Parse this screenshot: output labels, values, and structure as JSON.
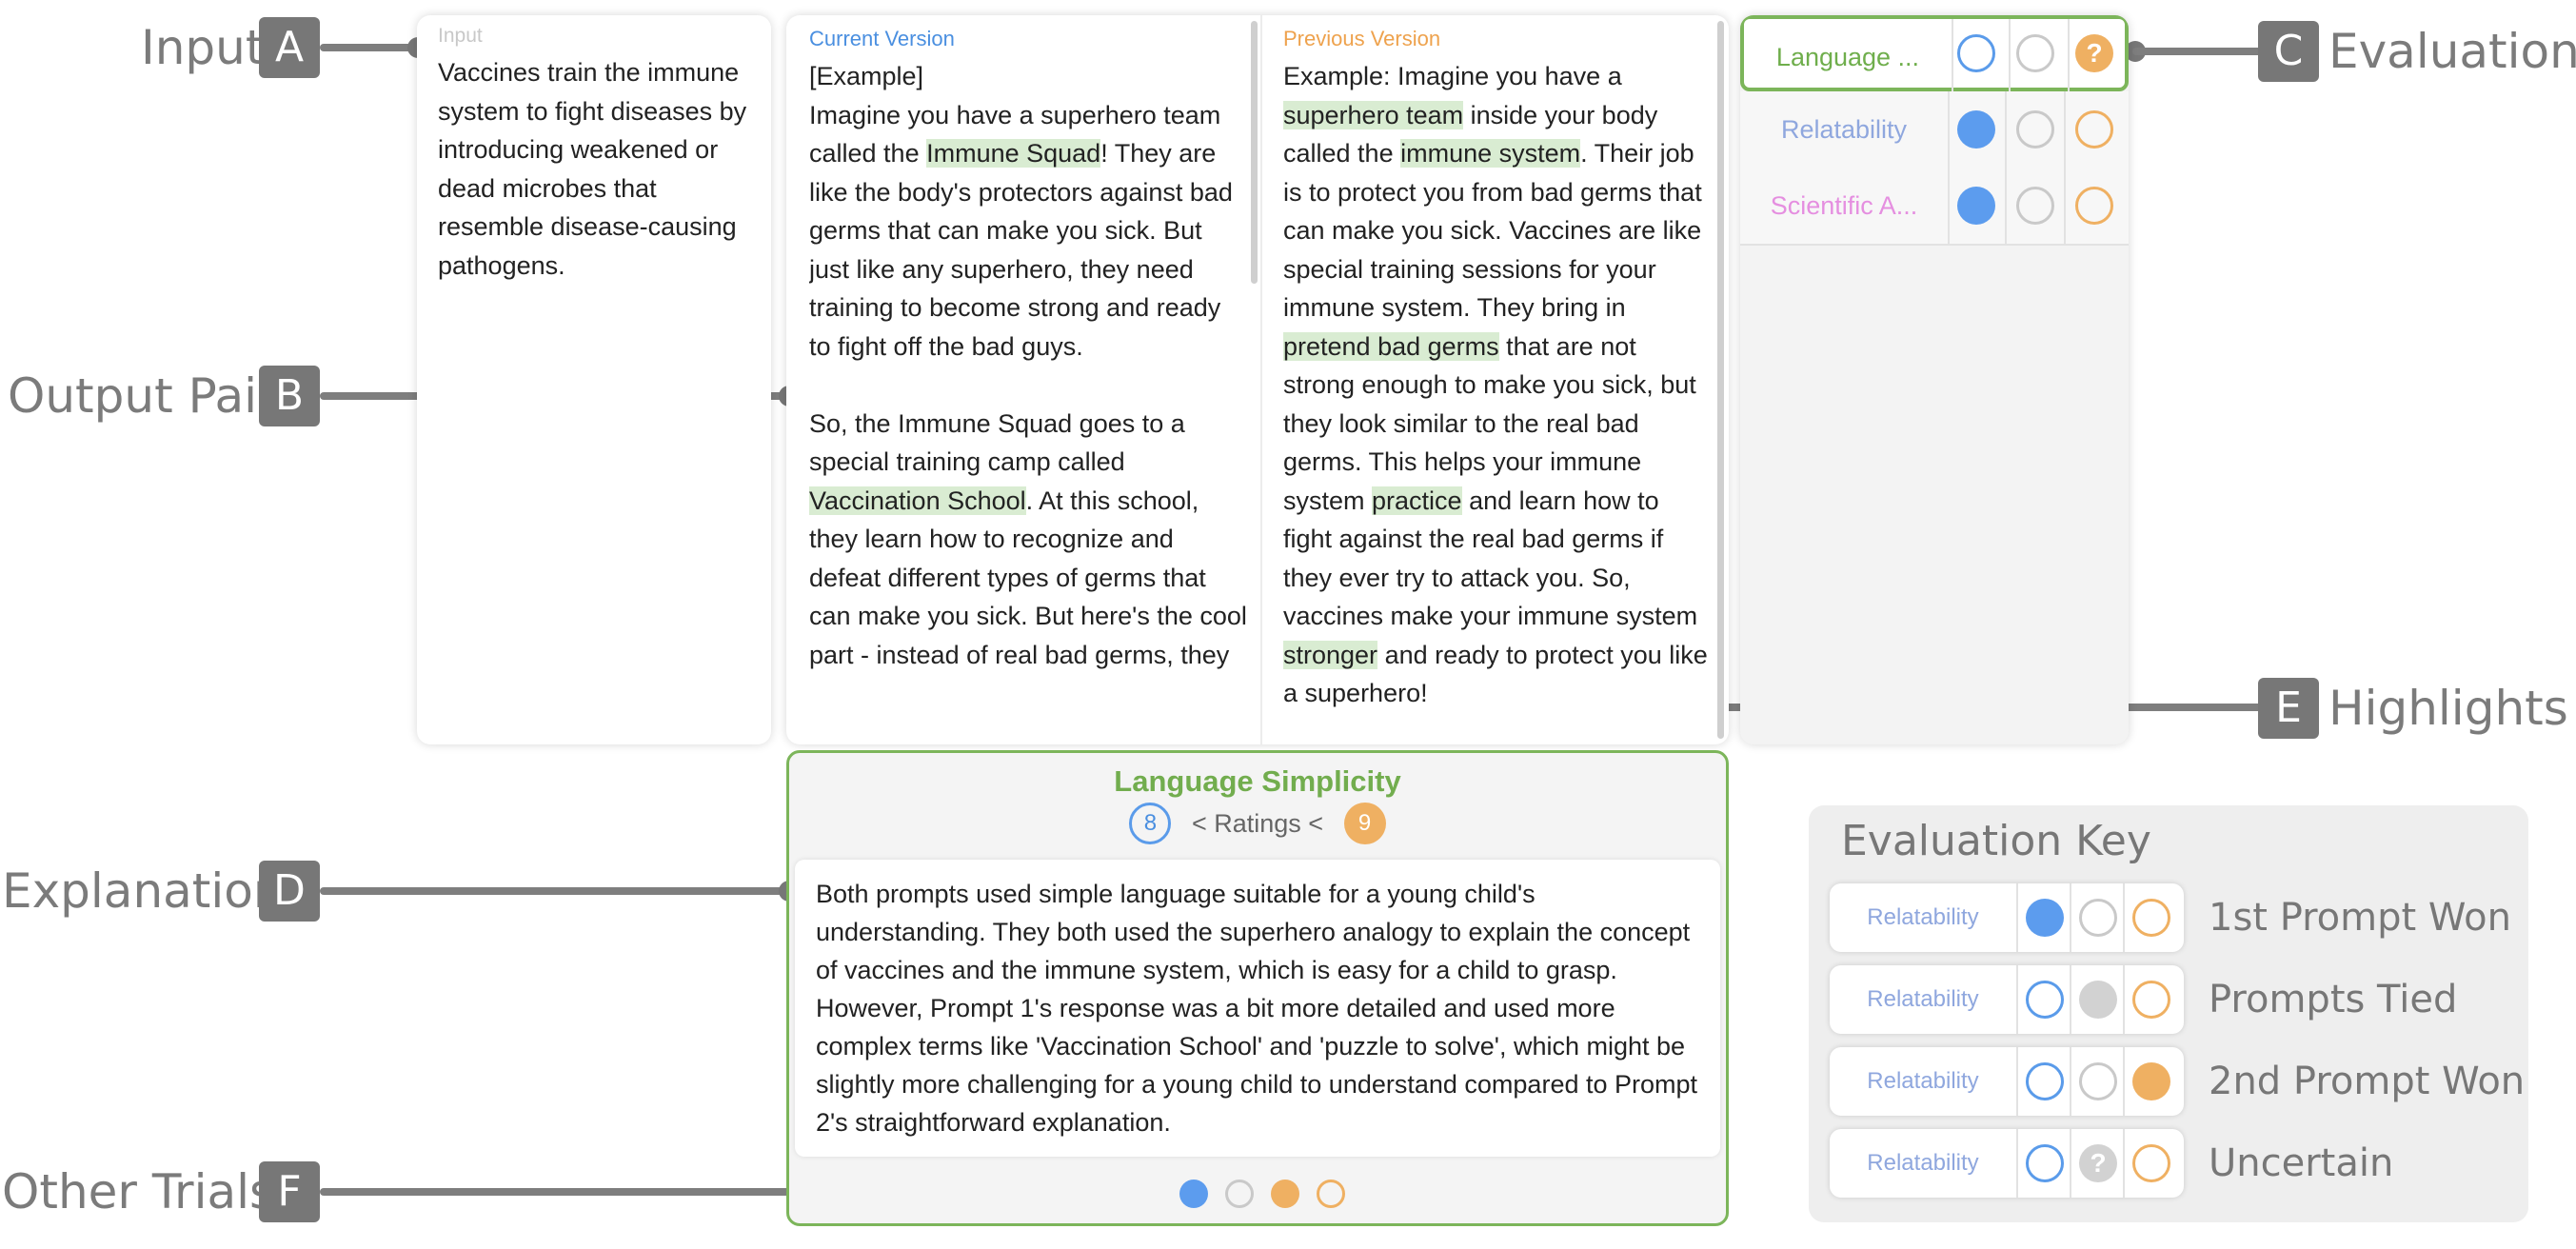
{
  "annotations": {
    "a": {
      "label": "Input",
      "letter": "A"
    },
    "b": {
      "label": "Output Pair",
      "letter": "B"
    },
    "c": {
      "label": "Evaluations",
      "letter": "C"
    },
    "d": {
      "label": "Explanation",
      "letter": "D"
    },
    "e": {
      "label": "Highlights",
      "letter": "E"
    },
    "f": {
      "label": "Other Trials",
      "letter": "F"
    }
  },
  "input_panel": {
    "header": "Input",
    "text": "Vaccines train the immune system to fight diseases by introducing weakened or dead microbes that resemble disease-causing pathogens."
  },
  "current_version": {
    "header": "Current Version",
    "segments": [
      {
        "t": "[Example]\nImagine you have a superhero team called the ",
        "h": false
      },
      {
        "t": "Immune Squad",
        "h": true
      },
      {
        "t": "! They are like the body's protectors against bad germs that can make you sick. But just like any superhero, they need training to become strong and ready to fight off the bad guys.\n\nSo, the Immune Squad goes to a special training camp called ",
        "h": false
      },
      {
        "t": "Vaccination School",
        "h": true
      },
      {
        "t": ". At this school, they learn how to recognize and defeat different types of germs that can make you sick. But here's the cool part - instead of real bad germs, they",
        "h": false
      }
    ]
  },
  "previous_version": {
    "header": "Previous Version",
    "segments": [
      {
        "t": "Example: Imagine you have a ",
        "h": false
      },
      {
        "t": "superhero team",
        "h": true
      },
      {
        "t": " inside your body called the ",
        "h": false
      },
      {
        "t": "immune system",
        "h": true
      },
      {
        "t": ". Their job is to protect you from bad germs that can make you sick. Vaccines are like special training sessions for your immune system. They bring in ",
        "h": false
      },
      {
        "t": "pretend bad germs",
        "h": true
      },
      {
        "t": " that are not strong enough to make you sick, but they look similar to the real bad germs. This helps your immune system ",
        "h": false
      },
      {
        "t": "practice",
        "h": true
      },
      {
        "t": " and learn how to fight against the real bad germs if they ever try to attack you. So, vaccines make your immune system ",
        "h": false
      },
      {
        "t": "stronger",
        "h": true
      },
      {
        "t": " and ready to protect you like a superhero!",
        "h": false
      }
    ]
  },
  "evaluations": [
    {
      "name": "Language ...",
      "color": "#6fae4c",
      "selected": true,
      "state": "uncertain"
    },
    {
      "name": "Relatability",
      "color": "#8fa7de",
      "selected": false,
      "state": "first"
    },
    {
      "name": "Scientific A...",
      "color": "#e58fe0",
      "selected": false,
      "state": "first"
    }
  ],
  "explanation": {
    "title": "Language Simplicity",
    "rating_left": "8",
    "ratings_text": "< Ratings <",
    "rating_right": "9",
    "text": "Both prompts used simple language suitable for a young child's understanding. They both used the superhero analogy to explain the concept of vaccines and the immune system, which is easy for a child to grasp. However, Prompt 1's response was a bit more detailed and used more complex terms like 'Vaccination School' and 'puzzle to solve', which might be slightly more challenging for a young child to understand compared to Prompt 2's straightforward explanation.",
    "trials": [
      "blue",
      "gray",
      "orange",
      "orange-out"
    ]
  },
  "evaluation_key": {
    "title": "Evaluation Key",
    "rows": [
      {
        "criterion": "Relatability",
        "state": "first",
        "label": "1st Prompt Won"
      },
      {
        "criterion": "Relatability",
        "state": "tied",
        "label": "Prompts Tied"
      },
      {
        "criterion": "Relatability",
        "state": "second",
        "label": "2nd Prompt Won"
      },
      {
        "criterion": "Relatability",
        "state": "uncertain",
        "label": "Uncertain"
      }
    ]
  },
  "colors": {
    "blue": "#5c9cee",
    "orange": "#efb062",
    "green_border": "#7cb55a",
    "highlight": "#d9ecd2",
    "annotation_gray": "#777777"
  }
}
